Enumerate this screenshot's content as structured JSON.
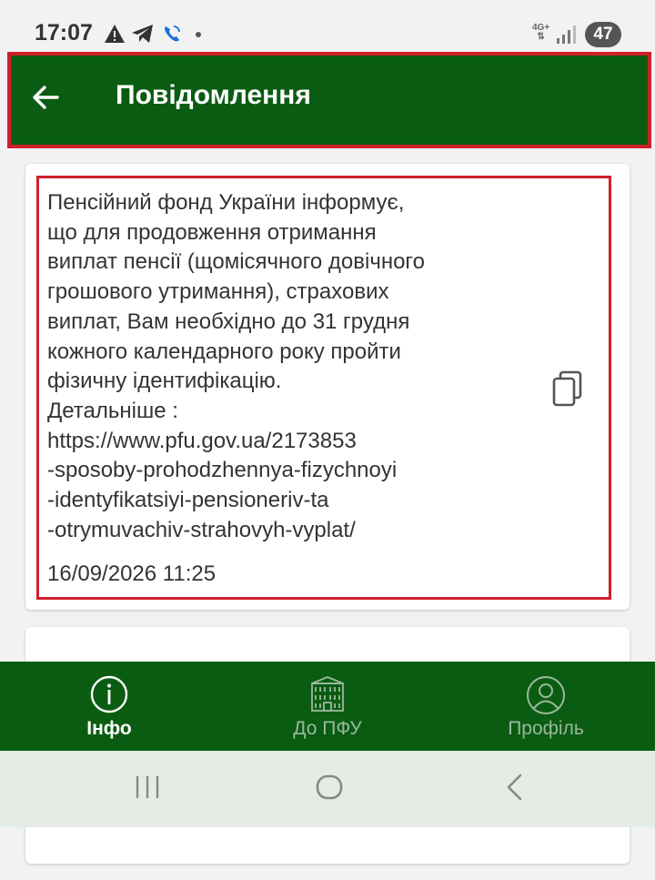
{
  "status_bar": {
    "time": "17:07",
    "network": "4G+",
    "battery": "47"
  },
  "app_bar": {
    "title": "Повідомлення"
  },
  "message": {
    "text": "  Пенсійний фонд України інформує,\nщо для продовження отримання\nвиплат пенсії (щомісячного довічного\nгрошового утримання), страхових\nвиплат, Вам необхідно до 31 грудня\nкожного календарного року пройти\nфізичну ідентифікацію.\nДетальніше :\nhttps://www.pfu.gov.ua/2173853\n-sposoby-prohodzhennya-fizychnoyi\n-identyfikatsiyi-pensioneriv-ta\n-otrymuvachiv-strahovyh-vyplat/",
    "date": "16/09/2026 11:25"
  },
  "bottom_nav": {
    "items": [
      {
        "label": "Інфо",
        "icon": "info-icon",
        "active": true
      },
      {
        "label": "До ПФУ",
        "icon": "building-icon",
        "active": false
      },
      {
        "label": "Профіль",
        "icon": "profile-icon",
        "active": false
      }
    ]
  },
  "colors": {
    "primary": "#0a5c12",
    "highlight": "#d11f2a",
    "background": "#f2f2f2"
  }
}
